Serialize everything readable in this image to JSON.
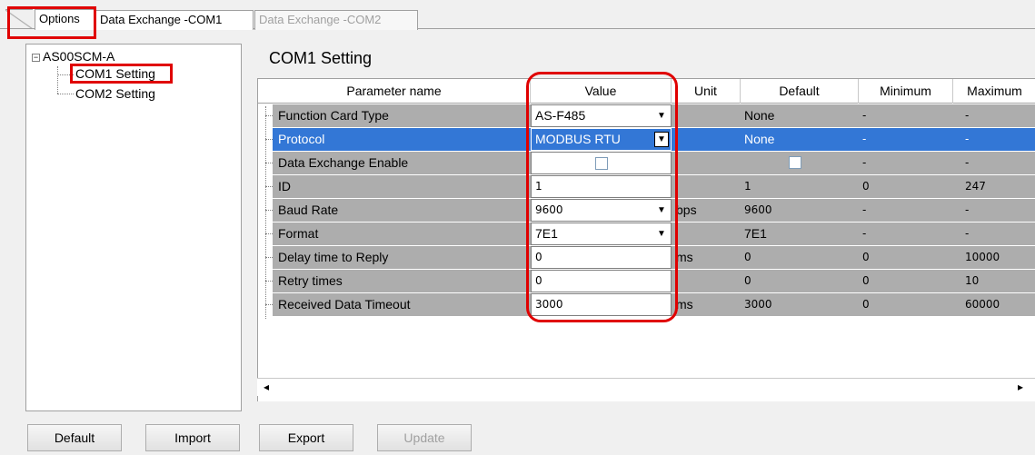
{
  "tabs": [
    {
      "label": "Options",
      "state": "active"
    },
    {
      "label": "Data Exchange -COM1",
      "state": "normal"
    },
    {
      "label": "Data Exchange -COM2",
      "state": "disabled"
    }
  ],
  "tree": {
    "root": "AS00SCM-A",
    "expander": "⊟",
    "items": [
      {
        "label": "COM1 Setting",
        "selected": true
      },
      {
        "label": "COM2 Setting",
        "selected": false
      }
    ]
  },
  "section_title": "COM1 Setting",
  "grid": {
    "columns": [
      "Parameter name",
      "Value",
      "Unit",
      "Default",
      "Minimum",
      "Maximum"
    ],
    "rows": [
      {
        "name": "Function Card Type",
        "value": "AS-F485",
        "value_type": "dropdown",
        "unit": "",
        "default": "None",
        "min": "-",
        "max": "-"
      },
      {
        "name": "Protocol",
        "value": "MODBUS RTU",
        "value_type": "dropdown",
        "unit": "",
        "default": "None",
        "min": "-",
        "max": "-",
        "selected": true
      },
      {
        "name": "Data Exchange Enable",
        "value": "",
        "value_type": "checkbox",
        "unit": "",
        "default": "",
        "min": "-",
        "max": "-"
      },
      {
        "name": "ID",
        "value": "1",
        "value_type": "text",
        "unit": "",
        "default": "1",
        "min": "0",
        "max": "247"
      },
      {
        "name": "Baud Rate",
        "value": "9600",
        "value_type": "dropdown",
        "unit": "bps",
        "default": "9600",
        "min": "-",
        "max": "-"
      },
      {
        "name": "Format",
        "value": "7E1",
        "value_type": "dropdown",
        "unit": "",
        "default": "7E1",
        "min": "-",
        "max": "-"
      },
      {
        "name": "Delay time to Reply",
        "value": "0",
        "value_type": "text",
        "unit": "ms",
        "default": "0",
        "min": "0",
        "max": "10000"
      },
      {
        "name": "Retry times",
        "value": "0",
        "value_type": "text",
        "unit": "",
        "default": "0",
        "min": "0",
        "max": "10"
      },
      {
        "name": "Received Data Timeout",
        "value": "3000",
        "value_type": "text",
        "unit": "ms",
        "default": "3000",
        "min": "0",
        "max": "60000"
      }
    ]
  },
  "scroll": {
    "left": "◂",
    "right": "▸"
  },
  "buttons": {
    "default": "Default",
    "import": "Import",
    "export": "Export",
    "update": "Update"
  },
  "colors": {
    "highlight_red": "#e00000",
    "selection_blue": "#3377d6",
    "row_gray": "#adadad"
  },
  "icons": {
    "dropdown": "▼"
  }
}
